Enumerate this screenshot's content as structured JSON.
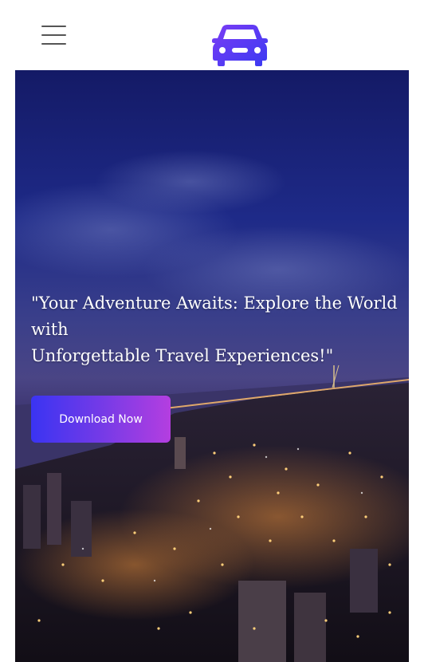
{
  "header": {
    "menu_icon": "hamburger-menu-icon",
    "logo_icon": "car-icon",
    "logo_gradient": [
      "#7b3cf5",
      "#3a3af2"
    ]
  },
  "hero": {
    "tagline_line1": "\"Your Adventure Awaits: Explore the World",
    "tagline_line2": "with",
    "tagline_line3": "Unforgettable Travel Experiences!\"",
    "download_label": "Download Now",
    "button_gradient": [
      "#3a34f2",
      "#b43ee0"
    ]
  }
}
